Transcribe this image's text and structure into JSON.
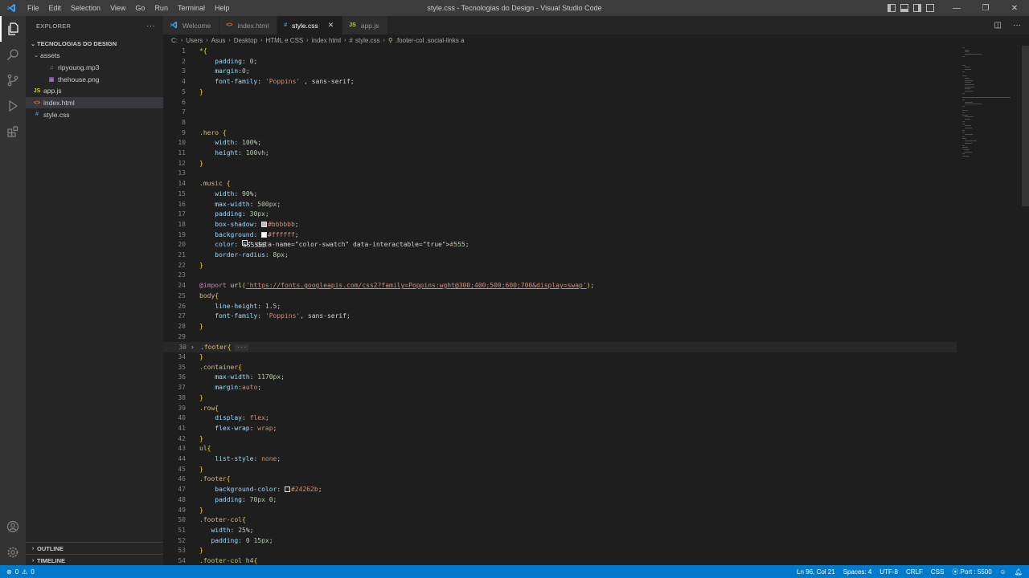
{
  "app": {
    "window_title": "style.css - Tecnologias do Design - Visual Studio Code",
    "menu": [
      "File",
      "Edit",
      "Selection",
      "View",
      "Go",
      "Run",
      "Terminal",
      "Help"
    ]
  },
  "window_controls": {
    "minimize": "—",
    "restore": "❐",
    "close": "✕"
  },
  "sidebar": {
    "title": "EXPLORER",
    "more": "···",
    "root": "TECNOLOGIAS DO DESIGN",
    "tree": [
      {
        "label": "assets",
        "kind": "folder",
        "expanded": true,
        "depth": 1
      },
      {
        "label": "ripyoung.mp3",
        "kind": "audio",
        "depth": 2
      },
      {
        "label": "thehouse.png",
        "kind": "image",
        "depth": 2
      },
      {
        "label": "app.js",
        "kind": "js",
        "icon": "JS",
        "depth": 1
      },
      {
        "label": "index.html",
        "kind": "html",
        "icon": "<>",
        "depth": 1,
        "selected": true
      },
      {
        "label": "style.css",
        "kind": "css",
        "icon": "#",
        "depth": 1
      }
    ],
    "outline": "OUTLINE",
    "timeline": "TIMELINE"
  },
  "tabs": [
    {
      "label": "Welcome",
      "icon": "vscode-icon",
      "active": false
    },
    {
      "label": "index.html",
      "icon": "<>",
      "active": false
    },
    {
      "label": "style.css",
      "icon": "#",
      "active": true,
      "close": "✕"
    },
    {
      "label": "app.js",
      "icon": "JS",
      "active": false
    }
  ],
  "breadcrumb": {
    "parts": [
      "C:",
      "Users",
      "Asus",
      "Desktop",
      "HTML e CSS",
      "index html",
      "style.css",
      ".footer-col .social-links a"
    ],
    "sep": "›"
  },
  "editor": {
    "lines": [
      {
        "n": "1",
        "t": "*{"
      },
      {
        "n": "2",
        "t": "    padding: 0;"
      },
      {
        "n": "3",
        "t": "    margin:0;"
      },
      {
        "n": "4",
        "t": "    font-family: 'Poppins' , sans-serif;"
      },
      {
        "n": "5",
        "t": "}"
      },
      {
        "n": "6",
        "t": ""
      },
      {
        "n": "7",
        "t": ""
      },
      {
        "n": "8",
        "t": ""
      },
      {
        "n": "9",
        "t": ".hero {"
      },
      {
        "n": "10",
        "t": "    width: 100%;"
      },
      {
        "n": "11",
        "t": "    height: 100vh;"
      },
      {
        "n": "12",
        "t": "}"
      },
      {
        "n": "13",
        "t": ""
      },
      {
        "n": "14",
        "t": ".music {"
      },
      {
        "n": "15",
        "t": "    width: 90%;"
      },
      {
        "n": "16",
        "t": "    max-width: 500px;"
      },
      {
        "n": "17",
        "t": "    padding: 30px;"
      },
      {
        "n": "18",
        "t": "    box-shadow: #bbbbbb;"
      },
      {
        "n": "19",
        "t": "    background: #ffffff;"
      },
      {
        "n": "20",
        "t": "    color: #555;"
      },
      {
        "n": "21",
        "t": "    border-radius: 8px;"
      },
      {
        "n": "22",
        "t": "}"
      },
      {
        "n": "23",
        "t": ""
      },
      {
        "n": "24",
        "t": "@import url('https://fonts.googleapis.com/css2?family=Poppins:wght@300;400;500;600;700&display=swap');"
      },
      {
        "n": "25",
        "t": "body{"
      },
      {
        "n": "26",
        "t": "    line-height: 1.5;"
      },
      {
        "n": "27",
        "t": "    font-family: 'Poppins', sans-serif;"
      },
      {
        "n": "28",
        "t": "}"
      },
      {
        "n": "29",
        "t": ""
      },
      {
        "n": "30",
        "t": ".footer{ ···"
      },
      {
        "n": "34",
        "t": "}"
      },
      {
        "n": "35",
        "t": ".container{"
      },
      {
        "n": "36",
        "t": "    max-width: 1170px;"
      },
      {
        "n": "37",
        "t": "    margin:auto;"
      },
      {
        "n": "38",
        "t": "}"
      },
      {
        "n": "39",
        "t": ".row{"
      },
      {
        "n": "40",
        "t": "    display: flex;"
      },
      {
        "n": "41",
        "t": "    flex-wrap: wrap;"
      },
      {
        "n": "42",
        "t": "}"
      },
      {
        "n": "43",
        "t": "ul{"
      },
      {
        "n": "44",
        "t": "    list-style: none;"
      },
      {
        "n": "45",
        "t": "}"
      },
      {
        "n": "46",
        "t": ".footer{"
      },
      {
        "n": "47",
        "t": "    background-color: #24262b;"
      },
      {
        "n": "48",
        "t": "    padding: 70px 0;"
      },
      {
        "n": "49",
        "t": "}"
      },
      {
        "n": "50",
        "t": ".footer-col{"
      },
      {
        "n": "51",
        "t": "   width: 25%;"
      },
      {
        "n": "52",
        "t": "   padding: 0 15px;"
      },
      {
        "n": "53",
        "t": "}"
      },
      {
        "n": "54",
        "t": ".footer-col h4{"
      }
    ],
    "swatches": {
      "#bbbbbb": "#bbbbbb",
      "#ffffff": "#ffffff",
      "#555": "#555555",
      "#24262b": "#24262b"
    }
  },
  "statusbar": {
    "errors": "0",
    "warnings": "0",
    "position": "Ln 96, Col 21",
    "spaces": "Spaces: 4",
    "encoding": "UTF-8",
    "eol": "CRLF",
    "language": "CSS",
    "port": "Port : 5500",
    "accent": "#007acc"
  }
}
